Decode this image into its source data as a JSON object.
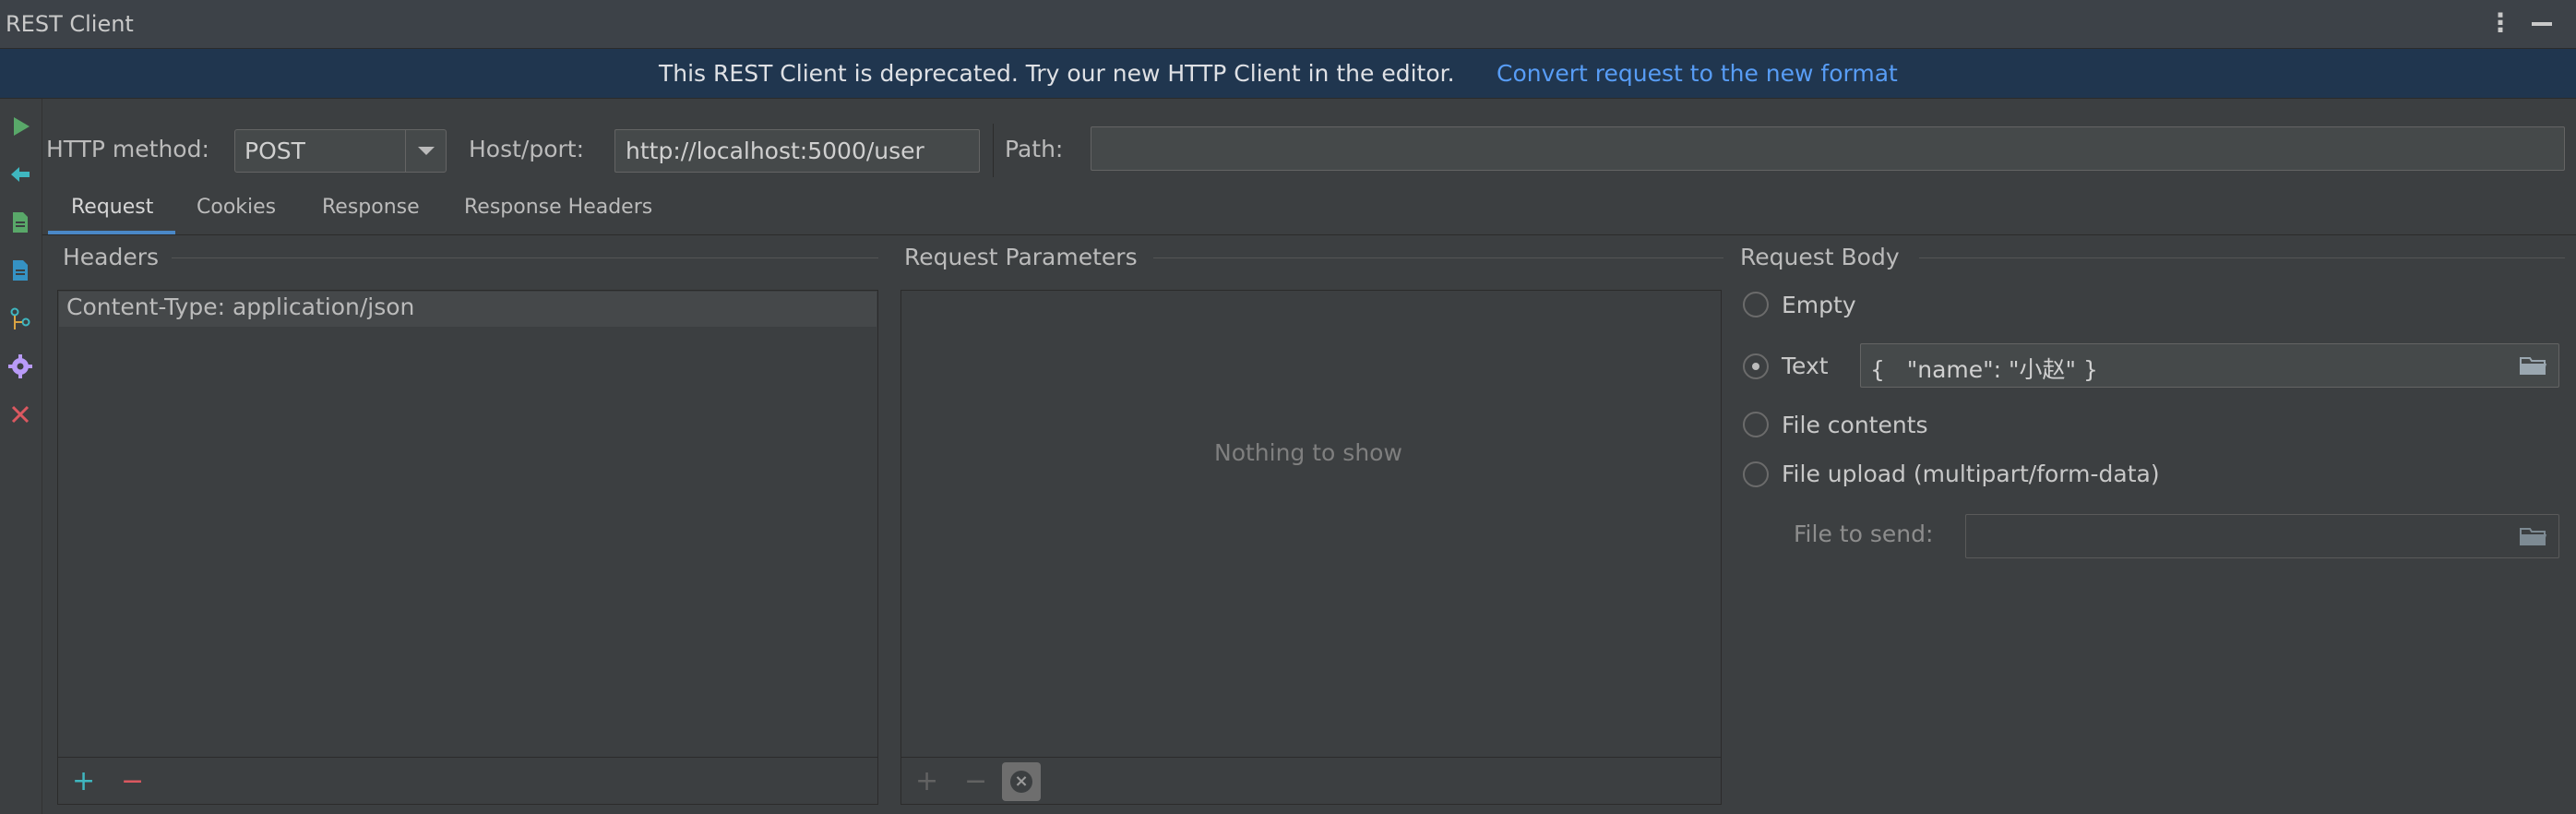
{
  "window": {
    "title": "REST Client"
  },
  "banner": {
    "message": "This REST Client is deprecated. Try our new HTTP Client in the editor.",
    "link": "Convert request to the new format"
  },
  "toolbar": {
    "icons": [
      "run-icon",
      "back-arrow-icon",
      "export-request-icon",
      "import-request-icon",
      "git-branch-icon",
      "settings-icon",
      "close-icon"
    ]
  },
  "request_line": {
    "method_label": "HTTP method:",
    "method_value": "POST",
    "host_label": "Host/port:",
    "host_value": "http://localhost:5000/user",
    "path_label": "Path:",
    "path_value": ""
  },
  "tabs": [
    {
      "label": "Request",
      "active": true
    },
    {
      "label": "Cookies",
      "active": false
    },
    {
      "label": "Response",
      "active": false
    },
    {
      "label": "Response Headers",
      "active": false
    }
  ],
  "headers": {
    "title": "Headers",
    "rows": [
      "Content-Type: application/json"
    ],
    "add": "+",
    "remove": "−"
  },
  "params": {
    "title": "Request Parameters",
    "empty": "Nothing to show",
    "add": "+",
    "remove": "−"
  },
  "body": {
    "title": "Request Body",
    "options": [
      {
        "label": "Empty",
        "checked": false
      },
      {
        "label": "Text",
        "checked": true
      },
      {
        "label": "File contents",
        "checked": false
      },
      {
        "label": "File upload (multipart/form-data)",
        "checked": false
      }
    ],
    "text_value": "{   \"name\": \"小赵\" }",
    "file_to_send_label": "File to send:",
    "file_to_send_value": ""
  },
  "colors": {
    "accent": "#4a88c7",
    "link": "#589df6",
    "run_green": "#59a869",
    "cyan": "#3592c4",
    "purple": "#b99bf8",
    "red": "#db5860"
  }
}
